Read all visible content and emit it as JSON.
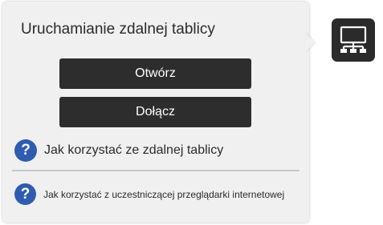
{
  "popup": {
    "title": "Uruchamianie zdalnej tablicy",
    "open_label": "Otwórz",
    "join_label": "Dołącz",
    "help_primary": "Jak korzystać ze zdalnej tablicy",
    "help_secondary": "Jak korzystać z uczestniczącej przeglądarki internetowej",
    "help_icon_glyph": "?"
  },
  "app_icon": {
    "name": "remote-whiteboard-network-icon"
  },
  "colors": {
    "panel_bg": "#f0f0f0",
    "button_bg": "#2d2d2d",
    "button_text": "#ffffff",
    "help_icon_bg": "#2e5caf",
    "tile_bg": "#2b2b2b"
  }
}
